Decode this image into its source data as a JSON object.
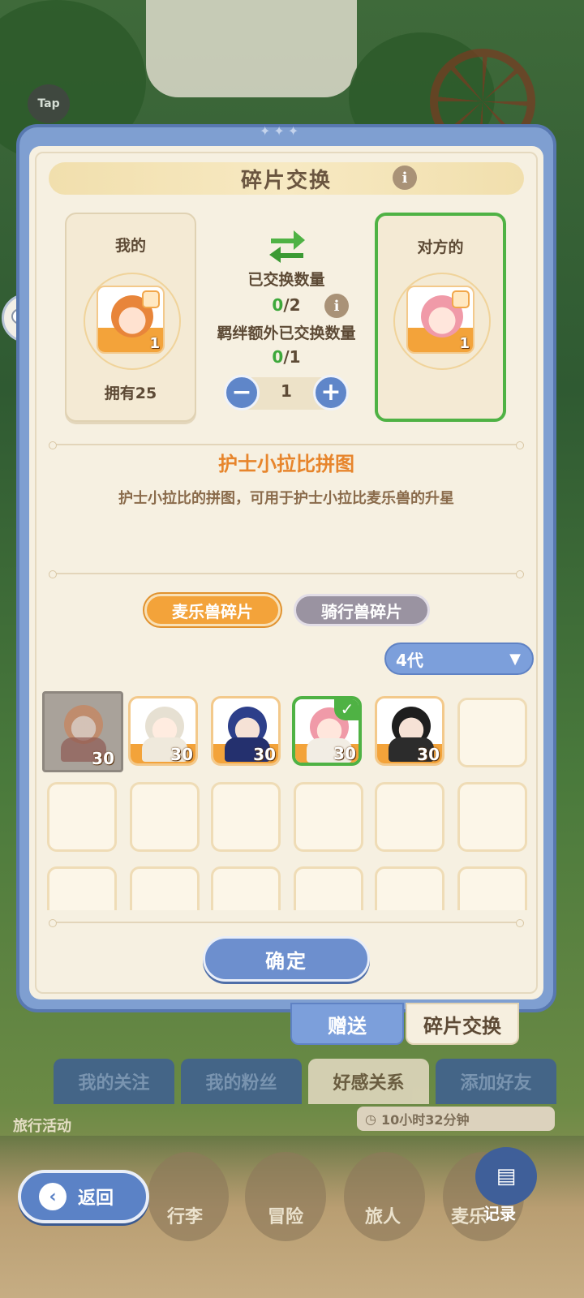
{
  "background": {
    "tap_badge": "Tap",
    "bottom_tabs": [
      "我的关注",
      "我的粉丝",
      "好感关系",
      "添加好友"
    ],
    "active_bottom_tab": "好感关系",
    "timer": "10小时32分钟",
    "travel_label": "旅行活动",
    "nav_items": [
      "行李",
      "冒险",
      "旅人",
      "麦乐"
    ],
    "back_label": "返回",
    "record_label": "记录"
  },
  "panel": {
    "title": "碎片交换",
    "mine": {
      "label": "我的",
      "tile_count": "1",
      "owned": "拥有25"
    },
    "theirs": {
      "label": "对方的",
      "tile_count": "1"
    },
    "exchanged_label": "已交换数量",
    "exchanged": {
      "current": "0",
      "total": "/2"
    },
    "bond_label": "羁绊额外已交换数量",
    "bond": {
      "current": "0",
      "total": "/1"
    },
    "stepper": {
      "minus": "−",
      "value": "1",
      "plus": "+"
    },
    "item_name": "护士小拉比拼图",
    "item_desc": "护士小拉比的拼图，可用于护士小拉比麦乐兽的升星",
    "filters": [
      "麦乐兽碎片",
      "骑行兽碎片"
    ],
    "active_filter": "麦乐兽碎片",
    "dropdown": "4代",
    "grid_items": [
      {
        "count": "30",
        "state": "dimmed",
        "hair": "#e8853a",
        "outfit": "#b83a3a"
      },
      {
        "count": "30",
        "state": "normal",
        "hair": "#f1ede4",
        "outfit": "#e9e2d2"
      },
      {
        "count": "30",
        "state": "normal",
        "hair": "#2d3f8a",
        "outfit": "#24306e"
      },
      {
        "count": "30",
        "state": "selected",
        "hair": "#f09aa8",
        "outfit": "#f2ede4"
      },
      {
        "count": "30",
        "state": "normal",
        "hair": "#1e1e1e",
        "outfit": "#2c2c2c"
      }
    ],
    "confirm_label": "确定"
  },
  "side_tabs": {
    "gift": "赠送",
    "swap": "碎片交换"
  },
  "colors": {
    "accent_blue": "#6d8fce",
    "accent_orange": "#f3a33a",
    "success_green": "#4fb244",
    "panel_bg": "#f6f0e1"
  }
}
